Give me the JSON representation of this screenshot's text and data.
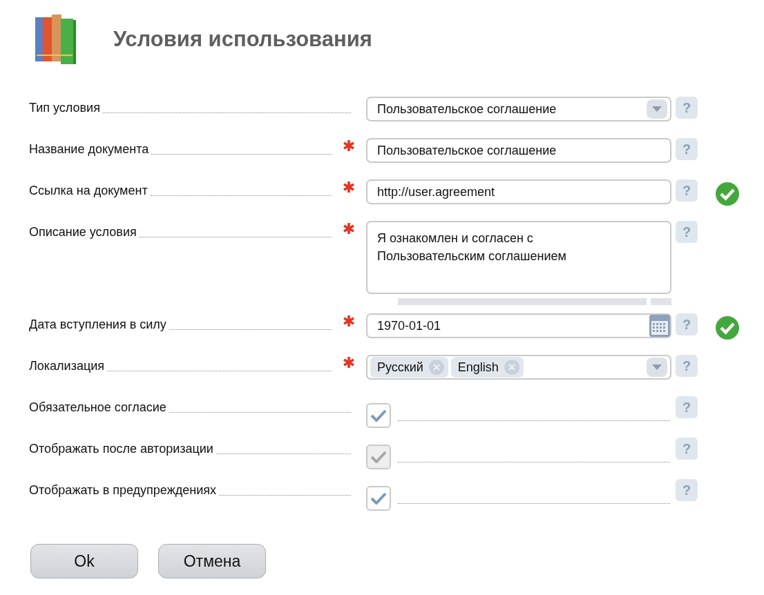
{
  "header": {
    "title": "Условия использования"
  },
  "fields": [
    {
      "kind": "select",
      "label": "Тип условия",
      "required": false,
      "value": "Пользовательское соглашение",
      "help": "?",
      "valid": false
    },
    {
      "kind": "text",
      "label": "Название документа",
      "required": true,
      "value": "Пользовательское соглашение",
      "help": "?",
      "valid": false
    },
    {
      "kind": "text",
      "label": "Ссылка на документ",
      "required": true,
      "value": "http://user.agreement",
      "help": "?",
      "valid": true
    },
    {
      "kind": "textarea",
      "label": "Описание условия",
      "required": true,
      "value": "Я ознакомлен и согласен с\nПользовательским соглашением",
      "help": "?",
      "valid": false
    },
    {
      "kind": "date",
      "label": "Дата вступления в силу",
      "required": true,
      "value": "1970-01-01",
      "help": "?",
      "valid": true
    },
    {
      "kind": "tags",
      "label": "Локализация",
      "required": true,
      "tags": [
        "Русский",
        "English"
      ],
      "help": "?",
      "valid": false
    },
    {
      "kind": "checkbox",
      "label": "Обязательное согласие",
      "required": false,
      "checked": true,
      "disabled": false,
      "help": "?",
      "valid": false
    },
    {
      "kind": "checkbox",
      "label": "Отображать после авторизации",
      "required": false,
      "checked": true,
      "disabled": true,
      "help": "?",
      "valid": false
    },
    {
      "kind": "checkbox",
      "label": "Отображать в предупреждениях",
      "required": false,
      "checked": true,
      "disabled": false,
      "help": "?",
      "valid": false
    }
  ],
  "buttons": [
    "Ok",
    "Отмена"
  ]
}
